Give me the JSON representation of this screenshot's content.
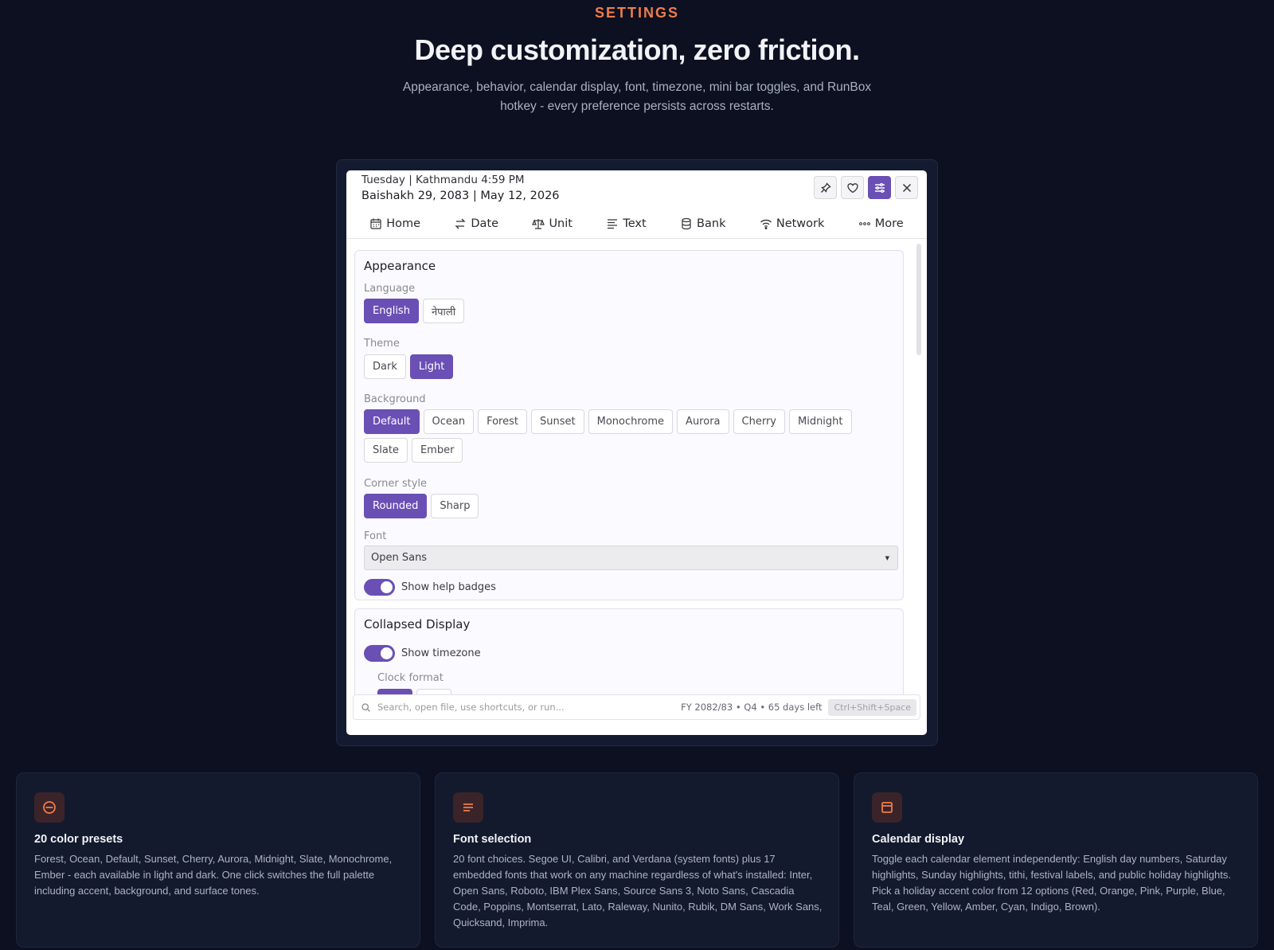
{
  "section": {
    "eyebrow": "SETTINGS",
    "headline": "Deep customization, zero friction.",
    "subtitle": "Appearance, behavior, calendar display, font, timezone, mini bar toggles, and RunBox hotkey - every preference persists across restarts."
  },
  "app": {
    "header": {
      "line1": "Tuesday | Kathmandu 4:59 PM",
      "line2": "Baishakh 29, 2083 | May 12, 2026",
      "icons": [
        "pin-icon",
        "heart-icon",
        "sliders-icon",
        "close-icon"
      ]
    },
    "nav": [
      {
        "label": "Home",
        "icon": "calendar-icon"
      },
      {
        "label": "Date",
        "icon": "swap-icon"
      },
      {
        "label": "Unit",
        "icon": "scale-icon"
      },
      {
        "label": "Text",
        "icon": "text-lines-icon"
      },
      {
        "label": "Bank",
        "icon": "database-icon"
      },
      {
        "label": "Network",
        "icon": "wifi-icon"
      },
      {
        "label": "More",
        "icon": "dots-icon"
      }
    ],
    "appearance": {
      "title": "Appearance",
      "language_label": "Language",
      "language_options": [
        "English",
        "नेपाली"
      ],
      "language_selected": "English",
      "theme_label": "Theme",
      "theme_options": [
        "Dark",
        "Light"
      ],
      "theme_selected": "Light",
      "background_label": "Background",
      "background_options": [
        "Default",
        "Ocean",
        "Forest",
        "Sunset",
        "Monochrome",
        "Aurora",
        "Cherry",
        "Midnight",
        "Slate",
        "Ember"
      ],
      "background_selected": "Default",
      "corner_label": "Corner style",
      "corner_options": [
        "Rounded",
        "Sharp"
      ],
      "corner_selected": "Rounded",
      "font_label": "Font",
      "font_value": "Open Sans",
      "help_badges_label": "Show help badges",
      "help_badges_on": true
    },
    "collapsed": {
      "title": "Collapsed Display",
      "timezone_label": "Show timezone",
      "timezone_on": true,
      "clock_format_label": "Clock format"
    },
    "footer": {
      "search_placeholder": "Search, open file, use shortcuts, or run...",
      "fy_info": "FY 2082/83 • Q4 • 65 days left",
      "hotkey": "Ctrl+Shift+Space"
    },
    "accent_color": "#6a4fb5"
  },
  "features": [
    {
      "icon": "circle-minus-icon",
      "title": "20 color presets",
      "body": "Forest, Ocean, Default, Sunset, Cherry, Aurora, Midnight, Slate, Monochrome, Ember - each available in light and dark. One click switches the full palette including accent, background, and surface tones."
    },
    {
      "icon": "text-lines-icon",
      "title": "Font selection",
      "body": "20 font choices. Segoe UI, Calibri, and Verdana (system fonts) plus 17 embedded fonts that work on any machine regardless of what's installed: Inter, Open Sans, Roboto, IBM Plex Sans, Source Sans 3, Noto Sans, Cascadia Code, Poppins, Montserrat, Lato, Raleway, Nunito, Rubik, DM Sans, Work Sans, Quicksand, Imprima."
    },
    {
      "icon": "calendar-panel-icon",
      "title": "Calendar display",
      "body": "Toggle each calendar element independently: English day numbers, Saturday highlights, Sunday highlights, tithi, festival labels, and public holiday highlights. Pick a holiday accent color from 12 options (Red, Orange, Pink, Purple, Blue, Teal, Green, Yellow, Amber, Cyan, Indigo, Brown)."
    }
  ],
  "colors": {
    "page_bg": "#0c1020",
    "eyebrow": "#f07c4a",
    "feature_icon": "#f07c4a"
  }
}
